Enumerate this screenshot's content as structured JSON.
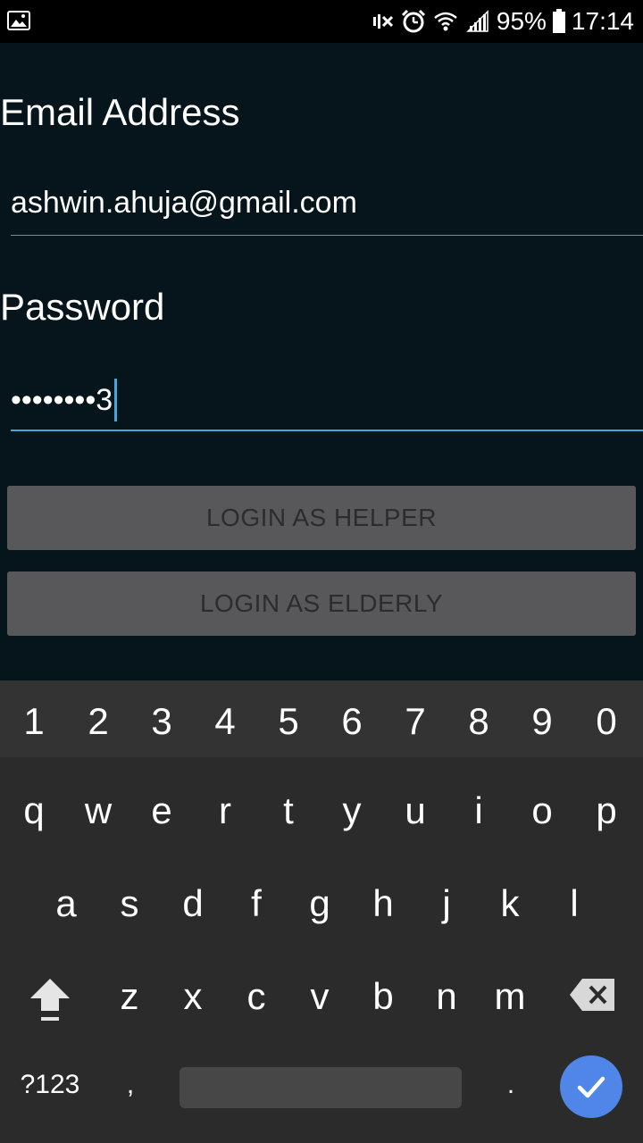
{
  "status_bar": {
    "battery_percent": "95%",
    "time": "17:14",
    "icons": [
      "image-icon",
      "mute-icon",
      "alarm-icon",
      "wifi-icon",
      "signal-icon",
      "battery-icon"
    ]
  },
  "form": {
    "email_label": "Email Address",
    "email_value": "ashwin.ahuja@gmail.com",
    "password_label": "Password",
    "password_value": "••••••••3"
  },
  "buttons": {
    "login_helper": "LOGIN AS HELPER",
    "login_elderly": "LOGIN AS ELDERLY"
  },
  "keyboard": {
    "numbers": [
      "1",
      "2",
      "3",
      "4",
      "5",
      "6",
      "7",
      "8",
      "9",
      "0"
    ],
    "row1": [
      "q",
      "w",
      "e",
      "r",
      "t",
      "y",
      "u",
      "i",
      "o",
      "p"
    ],
    "row2": [
      "a",
      "s",
      "d",
      "f",
      "g",
      "h",
      "j",
      "k",
      "l"
    ],
    "row3": [
      "z",
      "x",
      "c",
      "v",
      "b",
      "n",
      "m"
    ],
    "symbols_label": "?123",
    "comma": ",",
    "period": "."
  },
  "colors": {
    "background": "#06141b",
    "accent": "#4ba6d8",
    "button": "#58585a",
    "done": "#4f86e8"
  }
}
